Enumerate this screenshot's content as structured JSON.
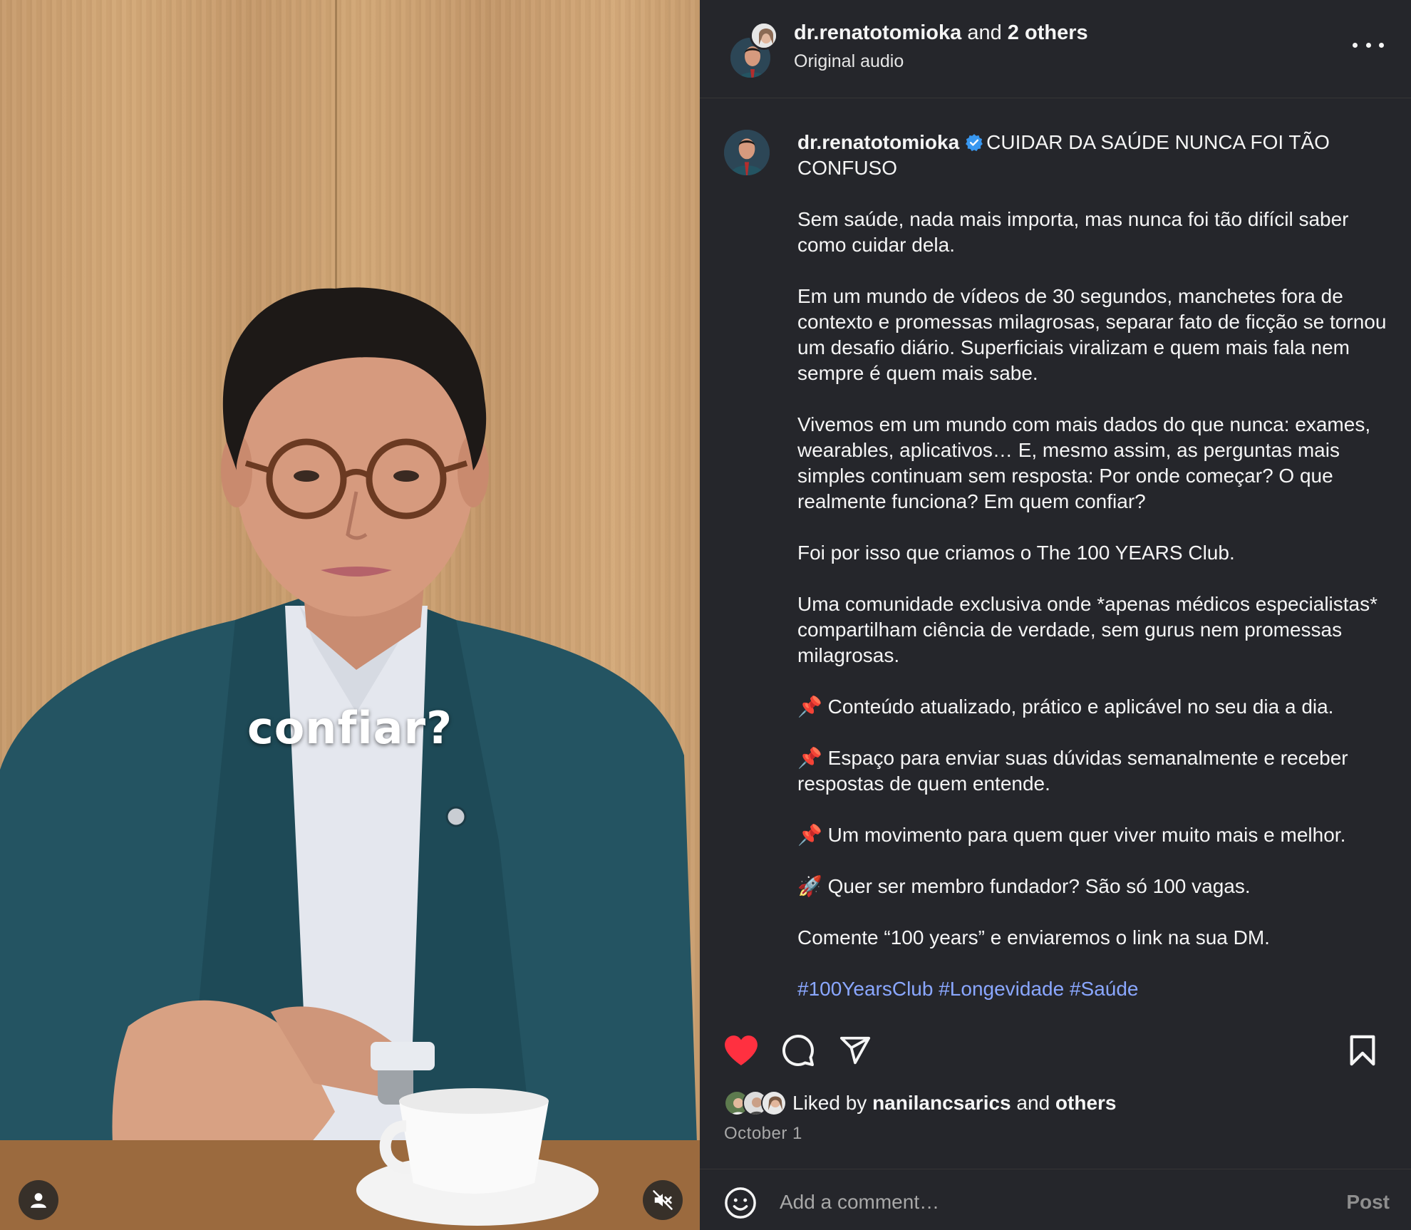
{
  "post_header": {
    "author": "dr.renatotomioka",
    "joiner": "and",
    "others": "2 others",
    "audio": "Original audio",
    "more_icon": "more-horizontal-icon"
  },
  "video": {
    "overlay_caption": "confiar?",
    "user_tag_icon": "person-icon",
    "mute_icon": "muted-speaker-icon"
  },
  "caption": {
    "username": "dr.renatotomioka",
    "verified_icon": "verified-badge-icon",
    "headline": "CUIDAR DA SAÚDE NUNCA FOI TÃO CONFUSO",
    "paragraphs": [
      "Sem saúde, nada mais importa, mas nunca foi tão difícil saber como cuidar dela.",
      "Em um mundo de vídeos de 30 segundos, manchetes fora de contexto e promessas milagrosas, separar fato de ficção se tornou um desafio diário. Superficiais viralizam e quem mais fala nem sempre é quem mais sabe.",
      "Vivemos em um mundo com mais dados do que nunca: exames, wearables, aplicativos… E, mesmo assim, as perguntas mais simples continuam sem resposta: Por onde começar? O que realmente funciona? Em quem confiar?",
      "Foi por isso que criamos o The 100 YEARS Club.",
      "Uma comunidade exclusiva onde *apenas médicos especialistas* compartilham ciência de verdade, sem gurus nem promessas milagrosas.",
      "📌 Conteúdo atualizado, prático e aplicável no seu dia a dia.",
      "📌 Espaço para enviar suas dúvidas semanalmente e receber respostas de quem entende.",
      "📌 Um movimento para quem quer viver muito mais e melhor.",
      "🚀 Quer ser membro fundador? São só 100 vagas.",
      "Comente “100 years” e enviaremos o link na sua DM."
    ],
    "hashtags": "#100YearsClub #Longevidade #Saúde"
  },
  "actions": {
    "like_icon": "heart-filled-icon",
    "comment_icon": "comment-bubble-icon",
    "share_icon": "paper-plane-icon",
    "save_icon": "bookmark-icon",
    "like_color": "#ff3040"
  },
  "likes": {
    "prefix": "Liked by",
    "user": "nanilancsarics",
    "joiner": "and",
    "others": "others"
  },
  "date": "October 1",
  "comment": {
    "emoji_icon": "smiley-face-icon",
    "placeholder": "Add a comment…",
    "post_label": "Post"
  },
  "colors": {
    "panel_bg": "#25262b",
    "link": "#8aa7ff",
    "verified": "#3897f0"
  }
}
